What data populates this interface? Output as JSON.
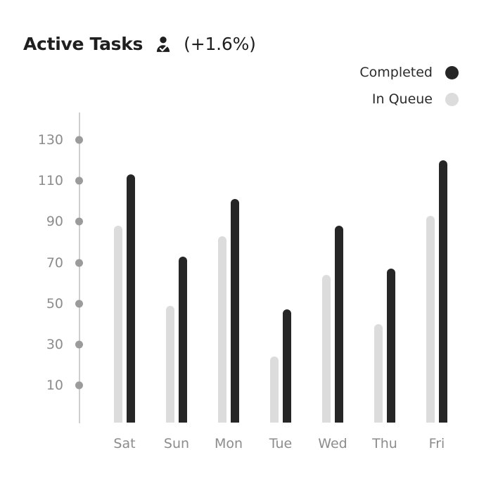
{
  "header": {
    "title": "Active Tasks",
    "icon": "person-check-icon",
    "delta": "(+1.6%)"
  },
  "legend": {
    "items": [
      {
        "label": "Completed",
        "color": "#262626",
        "key": "completed"
      },
      {
        "label": "In Queue",
        "color": "#dcdcdc",
        "key": "queue"
      }
    ]
  },
  "chart_data": {
    "type": "bar",
    "title": "Active Tasks",
    "subtitle": "(+1.6%)",
    "xlabel": "",
    "ylabel": "",
    "categories": [
      "Sat",
      "Sun",
      "Mon",
      "Tue",
      "Wed",
      "Thu",
      "Fri"
    ],
    "series": [
      {
        "name": "In Queue",
        "color": "#dcdcdc",
        "values": [
          88,
          49,
          83,
          24,
          64,
          40,
          93
        ]
      },
      {
        "name": "Completed",
        "color": "#262626",
        "values": [
          113,
          73,
          101,
          47,
          88,
          67,
          120
        ]
      }
    ],
    "ytick_labels": [
      "130",
      "110",
      "90",
      "70",
      "50",
      "30",
      "10"
    ],
    "yticks": [
      130,
      110,
      90,
      70,
      50,
      30,
      10
    ],
    "ylim": [
      0,
      140
    ],
    "grid": false,
    "legend_position": "top-right",
    "axis_color": "#cfcfcf",
    "tick_dot_color": "#9b9b9b",
    "tick_label_color": "#8c8c8c",
    "background": "#ffffff"
  }
}
